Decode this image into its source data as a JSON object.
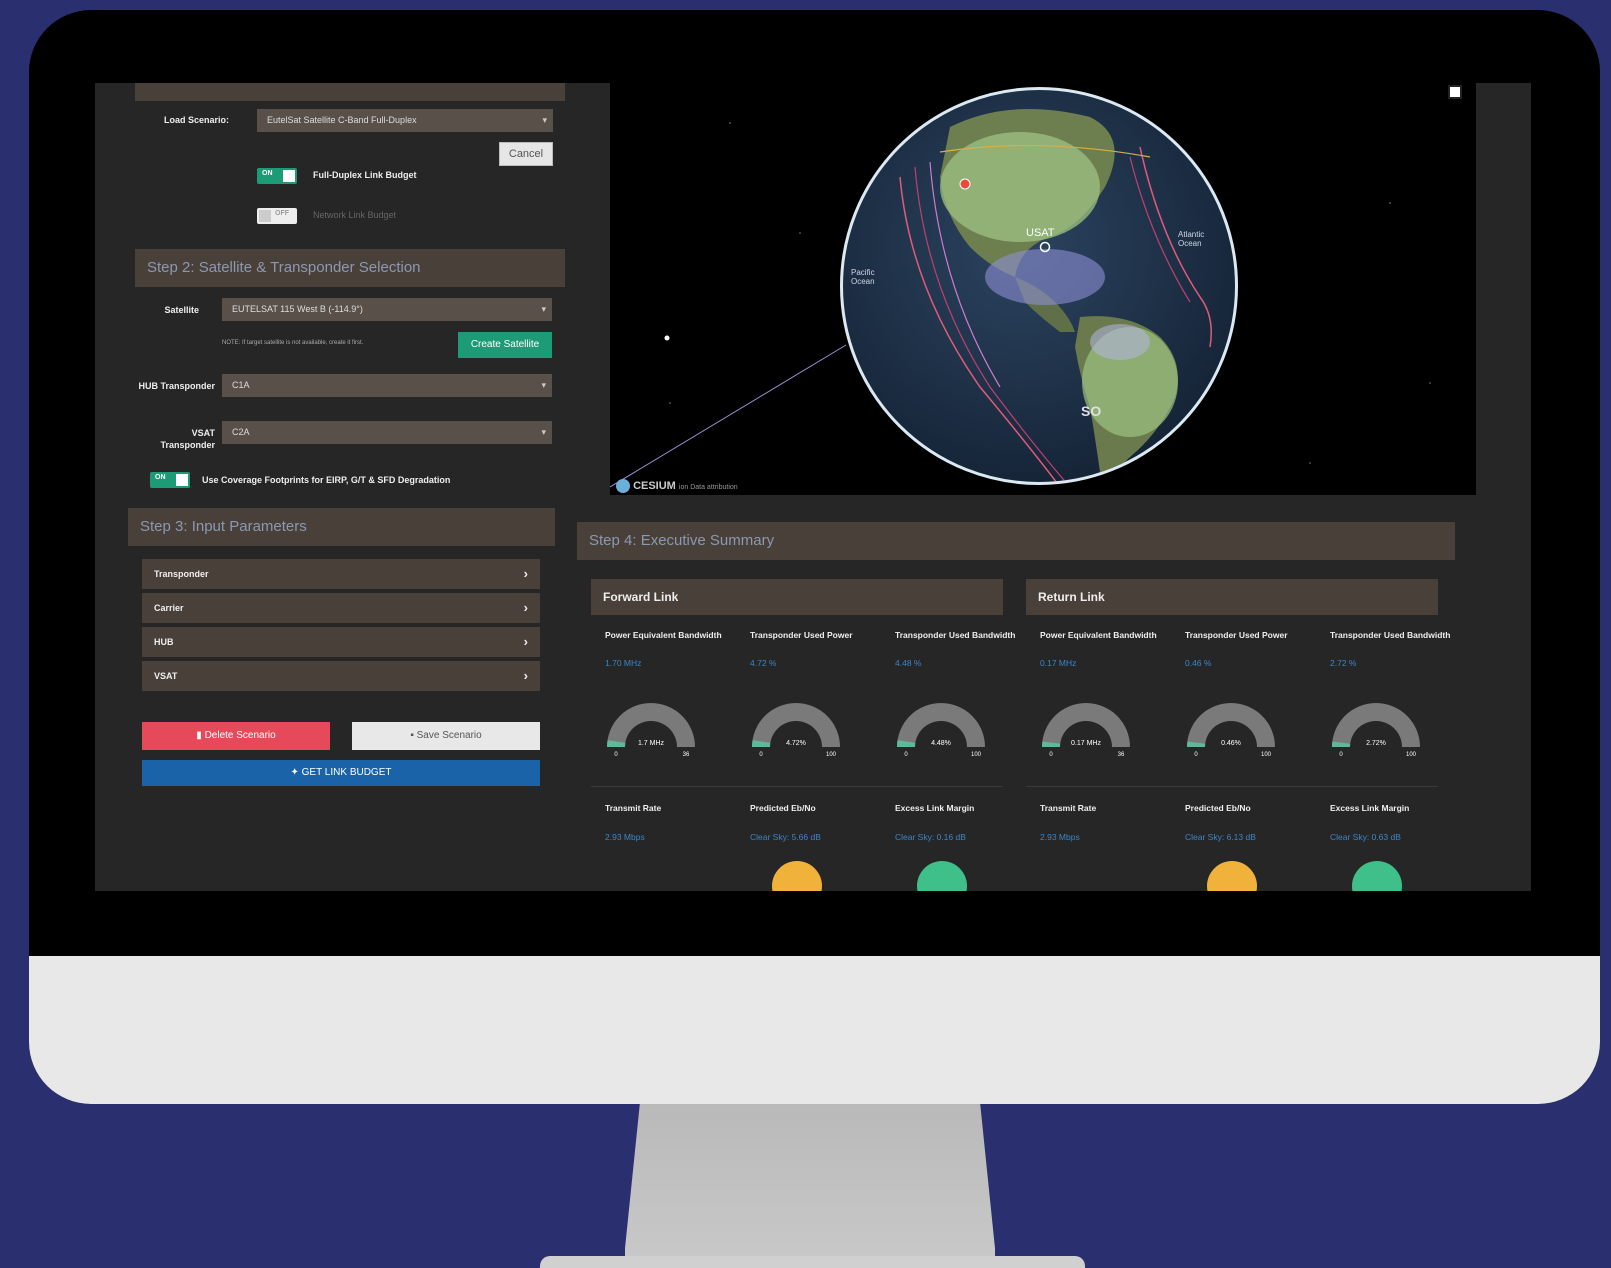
{
  "left": {
    "load_scenario_label": "Load Scenario:",
    "load_scenario_value": "EutelSat Satellite C-Band Full-Duplex",
    "cancel_label": "Cancel",
    "toggle_on_text": "ON",
    "full_duplex_label": "Full-Duplex Link Budget",
    "toggle_off_text": "OFF",
    "network_label": "Network Link Budget",
    "step2_title": "Step 2: Satellite & Transponder Selection",
    "satellite_label": "Satellite",
    "satellite_value": "EUTELSAT 115 West B (-114.9°)",
    "note_text": "NOTE: If target satellite is not available, create it first.",
    "create_satellite_label": "Create Satellite",
    "hub_transponder_label": "HUB Transponder",
    "hub_transponder_value": "C1A",
    "vsat_transponder_label": "VSAT Transponder",
    "vsat_transponder_value": "C2A",
    "coverage_toggle_label": "Use Coverage Footprints for EIRP, G/T & SFD Degradation",
    "step3_title": "Step 3: Input Parameters",
    "accordion": [
      {
        "label": "Transponder"
      },
      {
        "label": "Carrier"
      },
      {
        "label": "HUB"
      },
      {
        "label": "VSAT"
      }
    ],
    "delete_label": "Delete Scenario",
    "save_label": "Save Scenario",
    "get_label": "GET LINK BUDGET"
  },
  "map": {
    "cesium_logo": "CESIUM",
    "attribution": "ion  Data attribution",
    "usat_label": "USAT",
    "ocean_label_1": "Atlantic Ocean",
    "ocean_label_2": "Pacific Ocean",
    "south_label": "SO"
  },
  "step4_title": "Step 4: Executive Summary",
  "forward": {
    "title": "Forward Link",
    "metrics": [
      {
        "title": "Power Equivalent Bandwidth",
        "value": "1.70 MHz",
        "gauge_label": "1.7 MHz",
        "min": "0",
        "max": "36",
        "fraction": 0.05
      },
      {
        "title": "Transponder Used Power",
        "value": "4.72 %",
        "gauge_label": "4.72%",
        "min": "0",
        "max": "100",
        "fraction": 0.05
      },
      {
        "title": "Transponder Used Bandwidth",
        "value": "4.48 %",
        "gauge_label": "4.48%",
        "min": "0",
        "max": "100",
        "fraction": 0.05
      }
    ],
    "bottom": [
      {
        "title": "Transmit Rate",
        "value": "2.93 Mbps"
      },
      {
        "title": "Predicted Eb/No",
        "value": "Clear Sky: 5.66 dB"
      },
      {
        "title": "Excess Link Margin",
        "value": "Clear Sky: 0.16 dB"
      }
    ]
  },
  "return": {
    "title": "Return Link",
    "metrics": [
      {
        "title": "Power Equivalent Bandwidth",
        "value": "0.17 MHz",
        "gauge_label": "0.17 MHz",
        "min": "0",
        "max": "36",
        "fraction": 0.02
      },
      {
        "title": "Transponder Used Power",
        "value": "0.46 %",
        "gauge_label": "0.46%",
        "min": "0",
        "max": "100",
        "fraction": 0.01
      },
      {
        "title": "Transponder Used Bandwidth",
        "value": "2.72 %",
        "gauge_label": "2.72%",
        "min": "0",
        "max": "100",
        "fraction": 0.03
      }
    ],
    "bottom": [
      {
        "title": "Transmit Rate",
        "value": "2.93 Mbps"
      },
      {
        "title": "Predicted Eb/No",
        "value": "Clear Sky: 6.13 dB"
      },
      {
        "title": "Excess Link Margin",
        "value": "Clear Sky: 0.63 dB"
      }
    ]
  },
  "colors": {
    "gauge_track": "#7a7a7a",
    "gauge_fill": "#5fb89a",
    "accent_blue": "#3a86c8"
  }
}
